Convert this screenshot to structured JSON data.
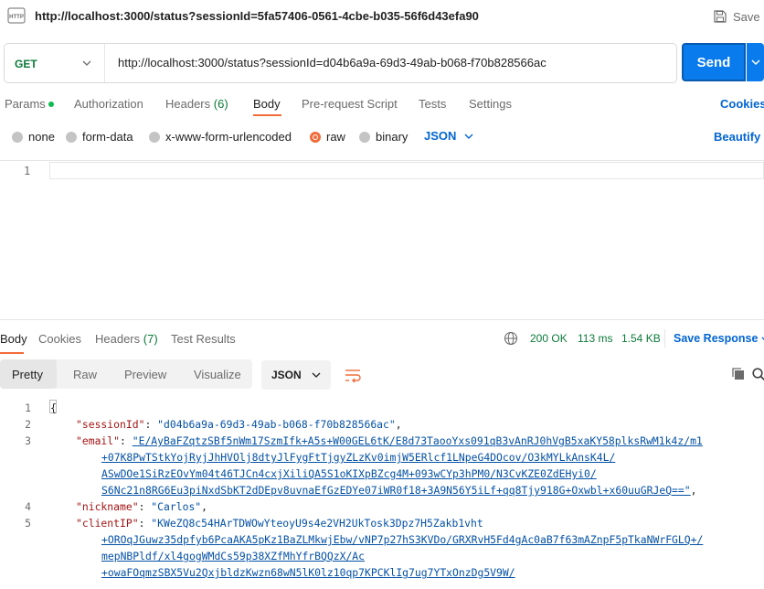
{
  "request": {
    "title": "http://localhost:3000/status?sessionId=5fa57406-0561-4cbe-b035-56f6d43efa90",
    "save_label": "Save",
    "method": "GET",
    "url": "http://localhost:3000/status?sessionId=d04b6a9a-69d3-49ab-b068-f70b828566ac",
    "send_label": "Send",
    "icon": "http-icon"
  },
  "request_tabs": {
    "params": "Params",
    "authorization": "Authorization",
    "headers": "Headers",
    "headers_count": "(6)",
    "body": "Body",
    "prerequest": "Pre-request Script",
    "tests": "Tests",
    "settings": "Settings",
    "cookies": "Cookies"
  },
  "body_options": {
    "none": "none",
    "form_data": "form-data",
    "urlencoded": "x-www-form-urlencoded",
    "raw": "raw",
    "binary": "binary",
    "format": "JSON",
    "beautify": "Beautify",
    "selected": "raw"
  },
  "request_editor": {
    "line1": "1"
  },
  "response_tabs": {
    "body": "Body",
    "cookies": "Cookies",
    "headers": "Headers",
    "headers_count": "(7)",
    "test_results": "Test Results"
  },
  "response_status": {
    "code": "200 OK",
    "time": "113 ms",
    "size": "1.54 KB",
    "save_response": "Save Response"
  },
  "response_view": {
    "pretty": "Pretty",
    "raw": "Raw",
    "preview": "Preview",
    "visualize": "Visualize",
    "format": "JSON"
  },
  "response_body": {
    "line_numbers": [
      "1",
      "2",
      "3",
      "4",
      "5"
    ],
    "open_brace": "{",
    "session_key": "\"sessionId\"",
    "session_value": "\"d04b6a9a-69d3-49ab-b068-f70b828566ac\"",
    "email_key": "\"email\"",
    "email_lines": [
      "\"E/AyBaFZqtzSBf5nWm17SzmIfk+A5s+W00GEL6tK/E8d73TaooYxs091qB3vAnRJ0hVgB5xaKY58plksRwM1k4z/m1",
      "+07K8PwTStkYojRyjJhHVOlj8dtyJlFygFtTjgyZLzKv0imjW5ERlcf1LNpeG4DOcov/O3kMYLkAnsK4L/",
      "ASwDOe1SiRzEOvYm04t46TJCn4cxjXiliQA5S1oKIXpBZcg4M+093wCYp3hPM0/N3CvKZE0ZdEHyi0/",
      "S6Nc21n8RG6Eu3piNxdSbKT2dDEpv8uvnaEfGzEDYe07iWR0f18+3A9N56Y5iLf+qq8Tjy918G+Oxwbl+x60uuGRJeQ==\""
    ],
    "nickname_key": "\"nickname\"",
    "nickname_value": "\"Carlos\"",
    "clientip_key": "\"clientIP\"",
    "clientip_lines": [
      "\"KWeZQ8c54HArTDWOwYteoyU9s4e2VH2UkTosk3Dpz7H5Zakb1vht",
      "+OROqJGuwz35dpfyb6PcaAKA5pKz1BaZLMkwjEbw/vNP7p27hS3KVDo/GRXRvH5Fd4gAc0aB7f63mAZnpF5pTkaNWrFGLQ+/",
      "mepNBPldf/xl4gogWMdCs59p38XZfMhYfrBQQzX/Ac",
      "+owaFOqmzSBX5Vu2QxjbldzKwzn68wN5lK0lz10qp7KPCKlIg7ug7YTxOnzDg5V9W/"
    ]
  },
  "colors": {
    "accent": "#f26b3a",
    "send": "#097bed",
    "link": "#0265d2",
    "get": "#0c7a3a",
    "status_ok": "#0c7a3a"
  }
}
